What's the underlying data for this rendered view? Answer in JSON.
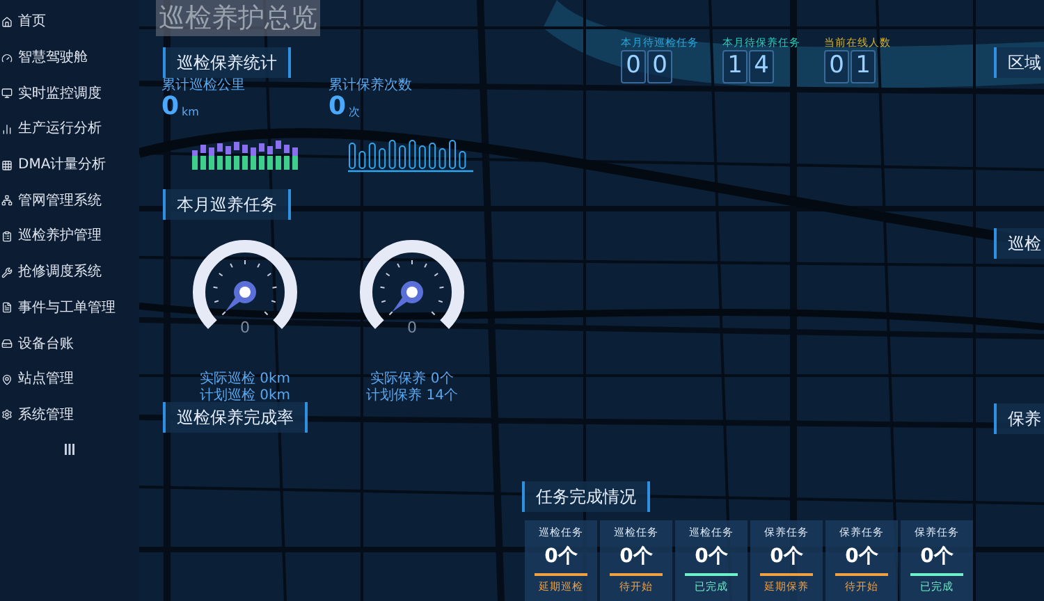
{
  "sidebar": {
    "items": [
      {
        "label": "首页",
        "selected": false
      },
      {
        "label": "智慧驾驶舱",
        "selected": false
      },
      {
        "label": "实时监控调度",
        "selected": false
      },
      {
        "label": "生产运行分析",
        "selected": false
      },
      {
        "label": "DMA计量分析",
        "selected": false
      },
      {
        "label": "管网管理系统",
        "selected": false
      },
      {
        "label": "巡检养护管理",
        "selected": false
      },
      {
        "label": "抢修调度系统",
        "selected": false
      },
      {
        "label": "事件与工单管理",
        "selected": false
      },
      {
        "label": "设备台账",
        "selected": false
      },
      {
        "label": "站点管理",
        "selected": false
      },
      {
        "label": "系统管理",
        "selected": false
      }
    ]
  },
  "page_title": "巡检养护总览",
  "stats_panel": {
    "title": "巡检保养统计",
    "metrics": [
      {
        "label": "累计巡检公里",
        "value": "0",
        "unit": "km"
      },
      {
        "label": "累计保养次数",
        "value": "0",
        "unit": "次"
      }
    ]
  },
  "monthly_panel": {
    "title": "本月巡养任务",
    "gauges": [
      {
        "value": "0",
        "lines": [
          "实际巡检 0km",
          "计划巡检 0km"
        ]
      },
      {
        "value": "0",
        "lines": [
          "实际保养 0个",
          "计划保养 14个"
        ]
      }
    ]
  },
  "completion_panel": {
    "title": "巡检保养完成率"
  },
  "counters": [
    {
      "label": "本月待巡检任务",
      "digits": [
        "0",
        "0"
      ],
      "color": "#22a8e0"
    },
    {
      "label": "本月待保养任务",
      "digits": [
        "1",
        "4"
      ],
      "color": "#1fd0c0"
    },
    {
      "label": "当前在线人数",
      "digits": [
        "0",
        "1"
      ],
      "color": "#d4b42a"
    }
  ],
  "right_panels": [
    {
      "title": "区域"
    },
    {
      "title": "巡检"
    },
    {
      "title": "保养"
    }
  ],
  "task_panel": {
    "title": "任务完成情况",
    "cards": [
      {
        "type": "巡检任务",
        "value": "0个",
        "status": "延期巡检",
        "color": "#f0a040"
      },
      {
        "type": "巡检任务",
        "value": "0个",
        "status": "待开始",
        "color": "#f0a040"
      },
      {
        "type": "巡检任务",
        "value": "0个",
        "status": "已完成",
        "color": "#6ef0c8"
      },
      {
        "type": "保养任务",
        "value": "0个",
        "status": "延期保养",
        "color": "#f0a040"
      },
      {
        "type": "保养任务",
        "value": "0个",
        "status": "待开始",
        "color": "#f0a040"
      },
      {
        "type": "保养任务",
        "value": "0个",
        "status": "已完成",
        "color": "#6ef0c8"
      }
    ]
  }
}
